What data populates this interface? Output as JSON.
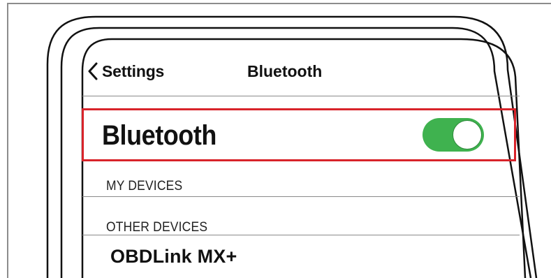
{
  "nav": {
    "back_label": "Settings",
    "title": "Bluetooth"
  },
  "bluetooth": {
    "label": "Bluetooth",
    "enabled": true,
    "toggle_color": "#3fb24f",
    "highlight_color": "#d8232a"
  },
  "sections": {
    "my_devices": "MY DEVICES",
    "other_devices": "OTHER DEVICES"
  },
  "devices": [
    {
      "name": "OBDLink MX+"
    }
  ]
}
